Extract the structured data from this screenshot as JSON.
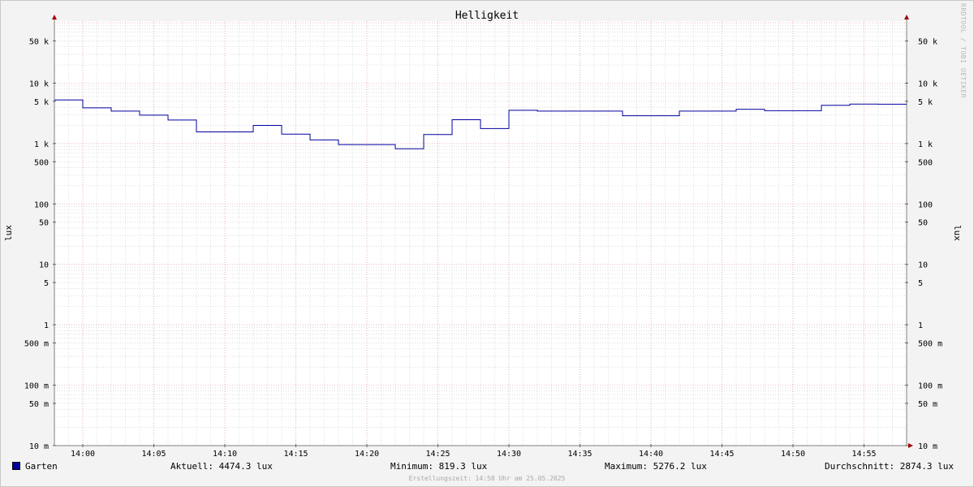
{
  "watermark": "RRDTOOL / TOBI OETIKER",
  "footer": "Erstellungszeit: 14:58 Uhr am 25.05.2025",
  "legend": {
    "series_name": "Garten",
    "current": "Aktuell: 4474.3 lux",
    "minimum": "Minimum: 819.3 lux",
    "maximum": "Maximum: 5276.2 lux",
    "average": "Durchschnitt: 2874.3 lux"
  },
  "colors": {
    "series": "#0000a0",
    "major_grid": "#e6a0a8",
    "minor_grid": "#c8c8c8",
    "axis_arrow": "#a00000"
  },
  "chart_data": {
    "type": "line",
    "title": "Helligkeit",
    "ylabel": "lux",
    "yscale": "log",
    "ylim": [
      0.01,
      100000
    ],
    "xlim": [
      "13:58",
      "15:58"
    ],
    "grid": true,
    "x_ticks": [
      "14:00",
      "14:05",
      "14:10",
      "14:15",
      "14:20",
      "14:25",
      "14:30",
      "14:35",
      "14:40",
      "14:45",
      "14:50",
      "14:55"
    ],
    "y_ticks": [
      {
        "value": 50000,
        "label": "50 k"
      },
      {
        "value": 10000,
        "label": "10 k"
      },
      {
        "value": 5000,
        "label": "5 k"
      },
      {
        "value": 1000,
        "label": "1 k"
      },
      {
        "value": 500,
        "label": "500"
      },
      {
        "value": 100,
        "label": "100"
      },
      {
        "value": 50,
        "label": "50"
      },
      {
        "value": 10,
        "label": "10"
      },
      {
        "value": 5,
        "label": "5"
      },
      {
        "value": 1,
        "label": "1"
      },
      {
        "value": 0.5,
        "label": "500 m"
      },
      {
        "value": 0.1,
        "label": "100 m"
      },
      {
        "value": 0.05,
        "label": "50 m"
      },
      {
        "value": 0.01,
        "label": "10 m"
      }
    ],
    "series": [
      {
        "name": "Garten",
        "step": true,
        "x": [
          "13:58",
          "14:00",
          "14:02",
          "14:04",
          "14:06",
          "14:08",
          "14:10",
          "14:12",
          "14:14",
          "14:16",
          "14:18",
          "14:20",
          "14:22",
          "14:24",
          "14:26",
          "14:28",
          "14:30",
          "14:32",
          "14:34",
          "14:36",
          "14:38",
          "14:40",
          "14:42",
          "14:44",
          "14:46",
          "14:48",
          "14:50",
          "14:52",
          "14:54",
          "14:56"
        ],
        "y": [
          5276,
          3900,
          3450,
          2950,
          2450,
          1560,
          1560,
          2000,
          1430,
          1150,
          960,
          960,
          819,
          1410,
          2480,
          1770,
          3550,
          3450,
          3450,
          3450,
          2880,
          2880,
          3450,
          3450,
          3700,
          3500,
          3500,
          4300,
          4500,
          4474
        ]
      }
    ]
  }
}
